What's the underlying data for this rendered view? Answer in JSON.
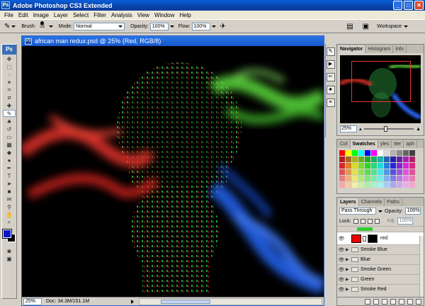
{
  "app": {
    "logo": "Ps",
    "title": "Adobe Photoshop CS3 Extended"
  },
  "menu": [
    "File",
    "Edit",
    "Image",
    "Layer",
    "Select",
    "Filter",
    "Analysis",
    "View",
    "Window",
    "Help"
  ],
  "options": {
    "brush_label": "Brush:",
    "brush_size": "35",
    "mode_label": "Mode:",
    "mode_value": "Normal",
    "opacity_label": "Opacity:",
    "opacity_value": "100%",
    "flow_label": "Flow:",
    "flow_value": "100%",
    "workspace_label": "Workspace"
  },
  "toolbox": {
    "badge": "Ps"
  },
  "document": {
    "title": "african man redux.psd @ 25% (Red, RGB/8)",
    "zoom": "25%",
    "doc_info": "Doc: 34.3M/151.1M"
  },
  "navigator": {
    "tabs": [
      "Navigator",
      "Histogram",
      "Info"
    ],
    "zoom": "25%"
  },
  "swatches": {
    "tabs": [
      "Col",
      "Swatches",
      "yles",
      "tter",
      "aph"
    ]
  },
  "layers_panel": {
    "tabs": [
      "Layers",
      "Channels",
      "Paths"
    ],
    "blend_mode": "Pass Through",
    "opacity_label": "Opacity:",
    "opacity_value": "100%",
    "lock_label": "Lock:",
    "fill_label": "Fill:",
    "fill_value": "100%",
    "red_layer_name": "red",
    "groups": [
      "Smoke Blue",
      "Blue",
      "Smoke Green",
      "Green",
      "Smoke Red"
    ]
  },
  "colors": {
    "foreground": "#0b16c8",
    "background": "#000000",
    "accent": "#0a5fd8"
  }
}
